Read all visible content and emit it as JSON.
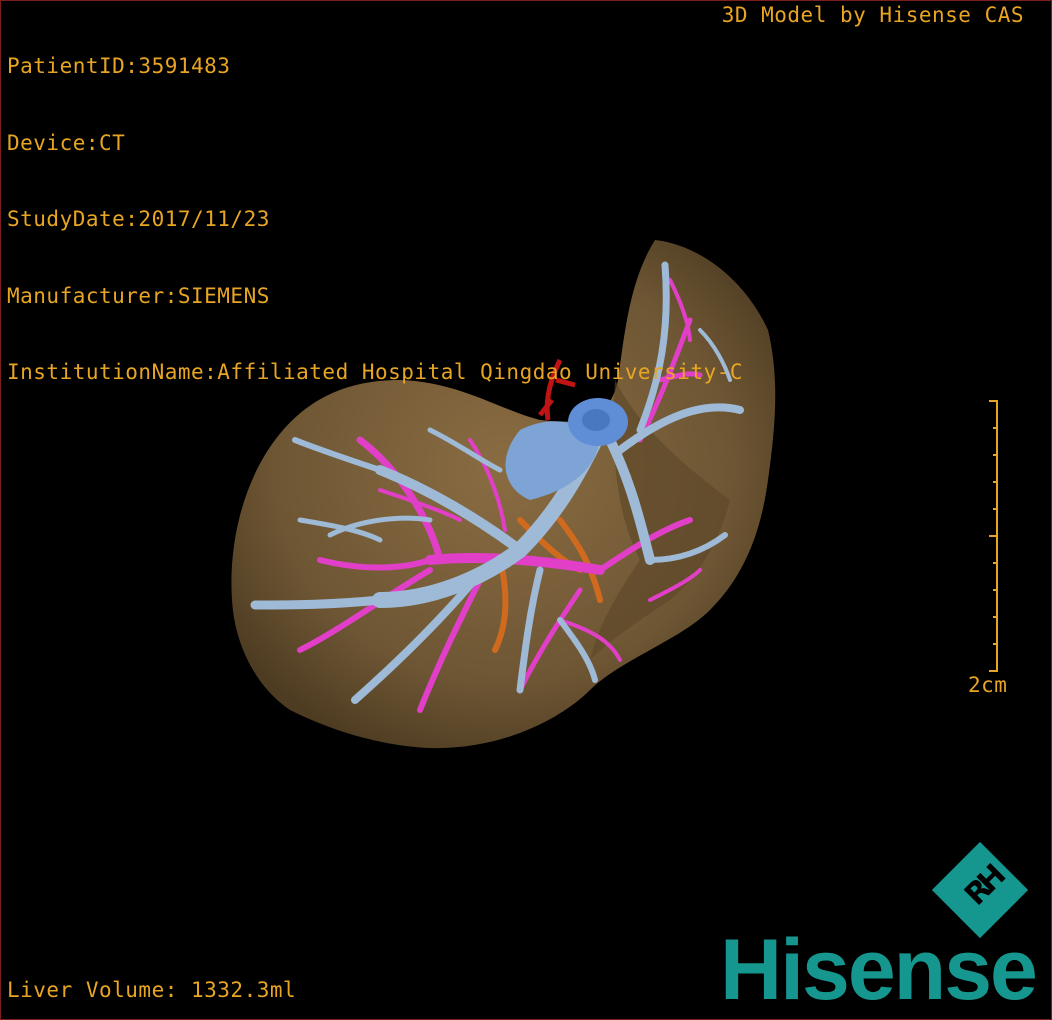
{
  "info": {
    "patient_id": "PatientID:3591483",
    "device": "Device:CT",
    "study_date": "StudyDate:2017/11/23",
    "manufacturer": "Manufacturer:SIEMENS",
    "institution": "InstitutionName:Affiliated Hospital Qingdao University-C"
  },
  "credit": "3D Model by Hisense CAS",
  "liver_volume": "Liver Volume: 1332.3ml",
  "scale_bar": {
    "label": "2cm"
  },
  "logo": {
    "word": "Hisense",
    "badge_letters": "RH"
  },
  "colors": {
    "text": "#e8a523",
    "liver": "#6e5634",
    "portal_vein": "#9fbad6",
    "hepatic_artery": "#e13fc8",
    "vena_cava": "#5f8ed6",
    "aorta": "#c01414",
    "brand": "#15978f"
  },
  "icons": [
    "hisense-rh-badge-icon",
    "scale-bar-icon"
  ]
}
